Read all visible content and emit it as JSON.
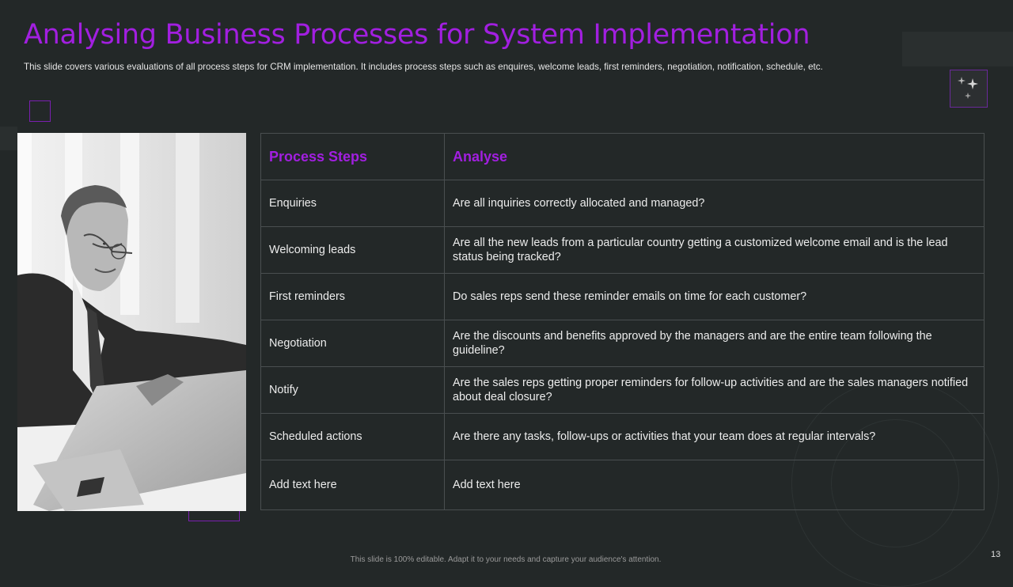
{
  "slide": {
    "title": "Analysing Business Processes for System Implementation",
    "subtitle": "This slide covers various evaluations of all process steps for CRM implementation. It includes process steps such as enquires, welcome leads, first reminders, negotiation, notification, schedule, etc.",
    "footer": "This slide is 100% editable.  Adapt it to your needs and capture your audience's attention.",
    "page_number": "13"
  },
  "table": {
    "headers": [
      "Process Steps",
      "Analyse"
    ],
    "rows": [
      {
        "step": "Enquiries",
        "analyse": "Are all inquiries correctly allocated and managed?"
      },
      {
        "step": "Welcoming leads",
        "analyse": "Are all the new leads from a particular country getting a customized welcome email and is the lead status being tracked?"
      },
      {
        "step": "First reminders",
        "analyse": "Do sales reps send these reminder emails on time for each customer?"
      },
      {
        "step": "Negotiation",
        "analyse": "Are the discounts and benefits approved by the managers and are the entire team following the guideline?"
      },
      {
        "step": "Notify",
        "analyse": "Are the sales reps getting proper reminders for follow-up activities and are the sales managers notified about deal closure?"
      },
      {
        "step": "Scheduled actions",
        "analyse": "Are there any tasks, follow-ups or activities that your team does at regular intervals?"
      },
      {
        "step": "Add text here",
        "analyse": "Add text here"
      }
    ]
  },
  "photo": {
    "icon": "businessman-laptop-photo"
  },
  "colors": {
    "accent": "#a21fe0",
    "background": "#232828",
    "border": "#4a4f50"
  }
}
